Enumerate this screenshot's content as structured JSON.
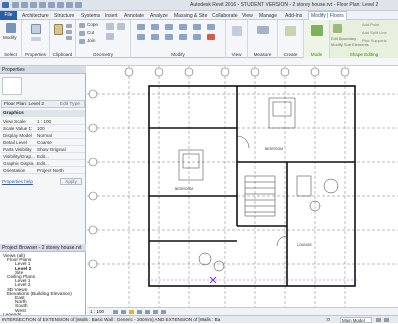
{
  "title_bar": {
    "title": "Autodesk Revit 2016 - STUDENT VERSION -    2 storey house.rvt - Floor Plan: Level 2"
  },
  "ribbon_tabs": [
    "File",
    "Architecture",
    "Structure",
    "Systems",
    "Insert",
    "Annotate",
    "Analyze",
    "Massing & Site",
    "Collaborate",
    "View",
    "Manage",
    "Add-Ins",
    "Modify | Floors"
  ],
  "ribbon": {
    "modify": "Modify",
    "select": "Select",
    "properties": "Properties",
    "cope": "Cope",
    "cut": "Cut",
    "join": "Join",
    "clipboard": "Clipboard",
    "geometry": "Geometry",
    "modify_group": "Modify",
    "view": "View",
    "measure": "Measure",
    "create": "Create",
    "mode": "Mode",
    "edit_boundary": "Edit Boundary",
    "modify_sub_elements": "Modify Sub Elements",
    "add_point": "Add Point",
    "add_split_line": "Add Split Line",
    "pick_supports": "Pick Supports",
    "shape_editing": "Shape Editing"
  },
  "properties_panel": {
    "header": "Properties",
    "type": "Floor Plan: Level 2",
    "edit_type": "Edit Type",
    "section": "Graphics",
    "rows": [
      {
        "k": "View Scale",
        "v": "1 : 100"
      },
      {
        "k": "Scale Value  1:",
        "v": "100"
      },
      {
        "k": "Display Model",
        "v": "Normal"
      },
      {
        "k": "Detail Level",
        "v": "Coarse"
      },
      {
        "k": "Parts Visibility",
        "v": "Show Original"
      },
      {
        "k": "Visibility/Grap...",
        "v": "Edit..."
      },
      {
        "k": "Graphic Displa...",
        "v": "Edit..."
      },
      {
        "k": "Orientation",
        "v": "Project North"
      }
    ],
    "help": "Properties help",
    "apply": "Apply"
  },
  "project_browser": {
    "header": "Project Browser - 2 storey house.rvt",
    "items": [
      {
        "label": "Views (all)",
        "indent": 0,
        "bold": false
      },
      {
        "label": "Floor Plans",
        "indent": 1,
        "bold": false
      },
      {
        "label": "Level 1",
        "indent": 3,
        "bold": false
      },
      {
        "label": "Level 2",
        "indent": 3,
        "bold": true
      },
      {
        "label": "Site",
        "indent": 3,
        "bold": false
      },
      {
        "label": "Ceiling Plans",
        "indent": 1,
        "bold": false
      },
      {
        "label": "Level 1",
        "indent": 3,
        "bold": false
      },
      {
        "label": "Level 2",
        "indent": 3,
        "bold": false
      },
      {
        "label": "3D Views",
        "indent": 1,
        "bold": false
      },
      {
        "label": "Elevations (Building Elevation)",
        "indent": 1,
        "bold": false
      },
      {
        "label": "East",
        "indent": 3,
        "bold": false
      },
      {
        "label": "North",
        "indent": 3,
        "bold": false
      },
      {
        "label": "South",
        "indent": 3,
        "bold": false
      },
      {
        "label": "West",
        "indent": 3,
        "bold": false
      },
      {
        "label": "Legends",
        "indent": 0,
        "bold": false
      },
      {
        "label": "Schedules/Quantities",
        "indent": 0,
        "bold": false
      }
    ]
  },
  "view_bar": {
    "scale": "1 : 100"
  },
  "status_bar": {
    "message": "INTERSECTION of EXTENSION of [Walls : Basic Wall : Generic - 200mm] AND EXTENSION of [Walls : Ba",
    "model": "Main Model",
    "zero": ":0"
  },
  "plan": {
    "room1": "BEDROOM",
    "room2": "BEDROOM",
    "room3": "LOUNGE"
  },
  "colors": {
    "file_tab": "#2c5ea8",
    "context_tab": "#e7f0dc",
    "context_label": "#3b8a1c",
    "selection": "#8a2be2"
  }
}
